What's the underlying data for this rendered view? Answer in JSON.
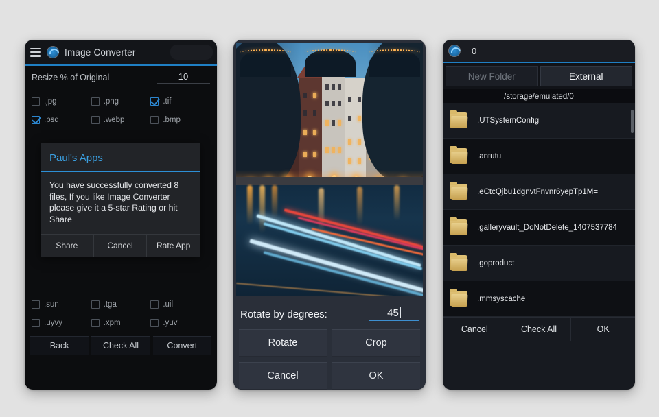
{
  "background_color": "#e2e2e2",
  "accent_color": "#2c8fd6",
  "converter_panel": {
    "header": {
      "menu_icon": "hamburger-menu-icon",
      "app_icon": "image-converter-icon",
      "title": "Image Converter"
    },
    "resize": {
      "label": "Resize % of Original",
      "value": "10"
    },
    "formats": [
      [
        {
          "label": ".jpg",
          "checked": false
        },
        {
          "label": ".png",
          "checked": false
        },
        {
          "label": ".tif",
          "checked": true
        }
      ],
      [
        {
          "label": ".psd",
          "checked": true
        },
        {
          "label": ".webp",
          "checked": false
        },
        {
          "label": ".bmp",
          "checked": false
        }
      ],
      [
        {
          "label": ".sun",
          "checked": false
        },
        {
          "label": ".tga",
          "checked": false
        },
        {
          "label": ".uil",
          "checked": false
        }
      ],
      [
        {
          "label": ".uyvy",
          "checked": false
        },
        {
          "label": ".xpm",
          "checked": false
        },
        {
          "label": ".yuv",
          "checked": false
        }
      ]
    ],
    "actions": {
      "back": "Back",
      "check_all": "Check All",
      "convert": "Convert"
    },
    "dialog": {
      "title": "Paul's Apps",
      "message": "You have successfully converted 8 files, If you like Image Converter please give it a 5-star Rating or hit Share",
      "buttons": [
        "Share",
        "Cancel",
        "Rate App"
      ]
    }
  },
  "editor_panel": {
    "photo_alt": "Amsterdam canal houses at dusk with light trails on the water",
    "rotate": {
      "label": "Rotate by degrees:",
      "value": "45"
    },
    "buttons": [
      "Rotate",
      "Crop",
      "Cancel",
      "OK"
    ]
  },
  "browser_panel": {
    "header": {
      "app_icon": "image-converter-icon",
      "selected_count": "0"
    },
    "tabs": [
      {
        "label": "New Folder",
        "active": false
      },
      {
        "label": "External",
        "active": true
      }
    ],
    "path": "/storage/emulated/0",
    "folders": [
      ".UTSystemConfig",
      ".antutu",
      ".eCtcQjbu1dgnvtFnvnr6yepTp1M=",
      ".galleryvault_DoNotDelete_1407537784",
      ".goproduct",
      ".mmsyscache"
    ],
    "buttons": [
      "Cancel",
      "Check All",
      "OK"
    ]
  }
}
